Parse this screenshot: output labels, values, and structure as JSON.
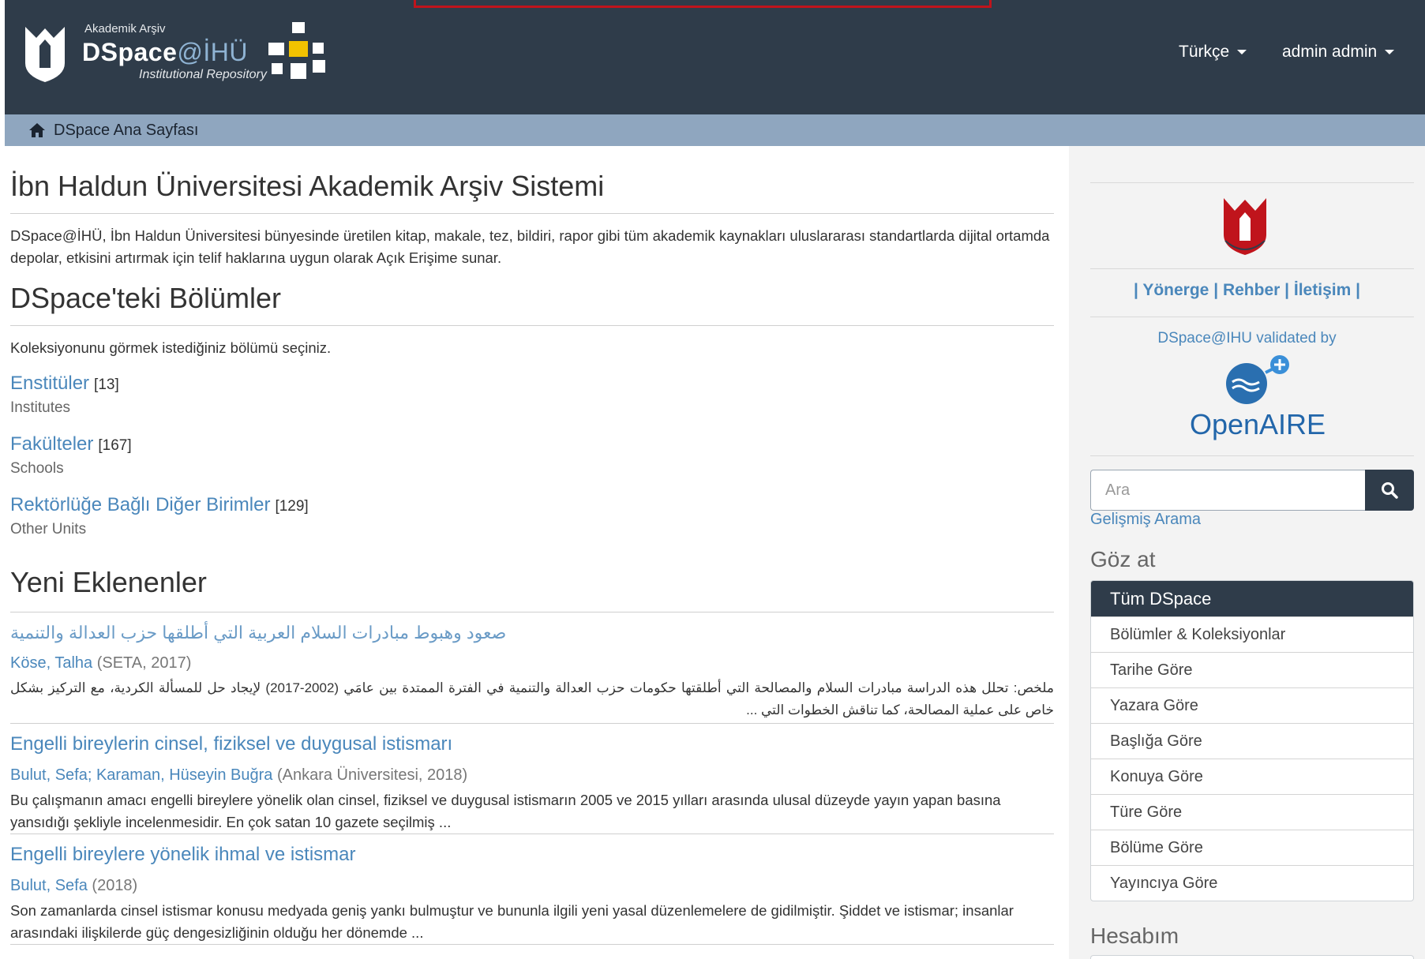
{
  "header": {
    "kicker": "Akademik Arşiv",
    "brand_main": "DSpace",
    "brand_at": "@İHÜ",
    "tagline": "Institutional Repository",
    "language": "Türkçe",
    "user": "admin admin"
  },
  "breadcrumb": {
    "home_label": "DSpace Ana Sayfası"
  },
  "main": {
    "title": "İbn Haldun Üniversitesi Akademik Arşiv Sistemi",
    "intro": "DSpace@İHÜ, İbn Haldun Üniversitesi bünyesinde üretilen kitap, makale, tez, bildiri, rapor gibi tüm akademik kaynakları uluslararası standartlarda dijital ortamda depolar, etkisini artırmak için telif haklarına uygun olarak Açık Erişime sunar.",
    "communities_title": "DSpace'teki Bölümler",
    "communities_instruction": "Koleksiyonunu görmek istediğiniz bölümü seçiniz.",
    "communities": [
      {
        "name": "Enstitüler",
        "count": "[13]",
        "description": "Institutes"
      },
      {
        "name": "Fakülteler",
        "count": "[167]",
        "description": "Schools"
      },
      {
        "name": "Rektörlüğe Bağlı Diğer Birimler",
        "count": "[129]",
        "description": "Other Units"
      }
    ],
    "recent_title": "Yeni Eklenenler",
    "recent_items": [
      {
        "title": "صعود وهبوط مبادرات السلام العربية التي أطلقها حزب العدالة والتنمية",
        "authors": "Köse, Talha",
        "pub": "(SETA, 2017)",
        "abstract": "ملخص: تحلل هذه الدراسة مبادرات السلام والمصالحة التي أطلقتها حكومات حزب العدالة والتنمية في الفترة الممتدة بين عامَي (2002-2017) لإيجاد حل للمسألة الكردية، مع التركيز بشكل خاص على عملية المصالحة، كما تناقش الخطوات التي ..."
      },
      {
        "title": "Engelli bireylerin cinsel, fiziksel ve duygusal istismarı",
        "authors": "Bulut, Sefa; Karaman, Hüseyin Buğra",
        "pub": "(Ankara Üniversitesi, 2018)",
        "abstract": "Bu çalışmanın amacı engelli bireylere yönelik olan cinsel, fiziksel ve duygusal istismarın 2005 ve 2015 yılları arasında ulusal düzeyde yayın yapan basına yansıdığı şekliyle incelenmesidir. En çok satan 10 gazete seçilmiş ..."
      },
      {
        "title": "Engelli bireylere yönelik ihmal ve istismar",
        "authors": "Bulut, Sefa",
        "pub": "(2018)",
        "abstract": "Son zamanlarda cinsel istismar konusu medyada geniş yankı bulmuştur ve bununla ilgili yeni yasal düzenlemelere de gidilmiştir. Şiddet ve istismar; insanlar arasındaki ilişkilerde güç dengesizliğinin olduğu her dönemde ..."
      }
    ]
  },
  "sidebar": {
    "links_sep": "|",
    "links": [
      "Yönerge",
      "Rehber",
      "İletişim"
    ],
    "validated_by": "DSpace@IHU validated by",
    "openaire_label": "OpenAIRE",
    "search_placeholder": "Ara",
    "advanced_search": "Gelişmiş Arama",
    "browse_title": "Göz at",
    "browse_items": [
      "Tüm DSpace",
      "Bölümler & Koleksiyonlar",
      "Tarihe Göre",
      "Yazara Göre",
      "Başlığa Göre",
      "Konuya Göre",
      "Türe Göre",
      "Bölüme Göre",
      "Yayıncıya Göre"
    ],
    "account_title": "Hesabım"
  },
  "colors": {
    "header_bg": "#2f3c4a",
    "breadcrumb_bg": "#8fa6bf",
    "link": "#4a87bb",
    "brand_red": "#c0141c"
  }
}
